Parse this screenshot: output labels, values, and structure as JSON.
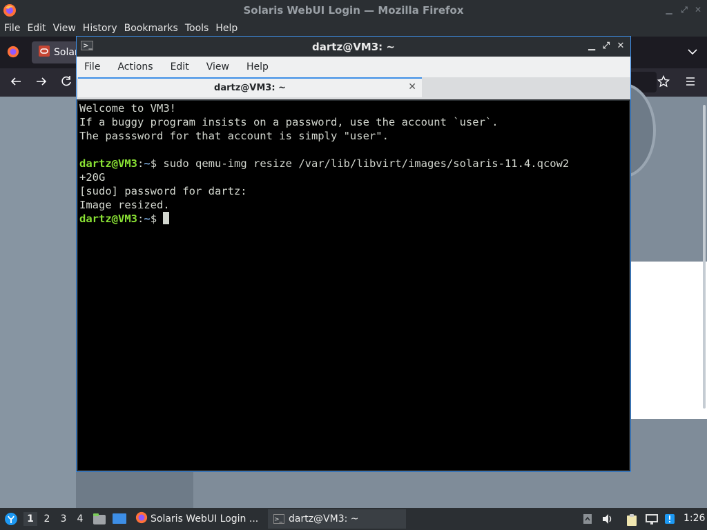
{
  "firefox": {
    "window_title": "Solaris WebUI Login — Mozilla Firefox",
    "menu": [
      "File",
      "Edit",
      "View",
      "History",
      "Bookmarks",
      "Tools",
      "Help"
    ],
    "tab_label": "Solar",
    "nav_icons": [
      "back-icon",
      "forward-icon",
      "reload-icon",
      "star-icon",
      "hamburger-menu-icon"
    ]
  },
  "terminal": {
    "window_title": "dartz@VM3: ~",
    "menu": [
      "File",
      "Actions",
      "Edit",
      "View",
      "Help"
    ],
    "tab_label": "dartz@VM3: ~",
    "lines": [
      "Welcome to VM3!",
      "If a buggy program insists on a password, use the account `user`.",
      "The passsword for that account is simply \"user\"."
    ],
    "prompt_user": "dartz@VM3",
    "prompt_sep": ":",
    "prompt_path": "~",
    "prompt_char": "$",
    "command": " sudo qemu-img resize /var/lib/libvirt/images/solaris-11.4.qcow2",
    "command_wrap": "+20G",
    "output": [
      "[sudo] password for dartz:",
      "Image resized."
    ]
  },
  "panel": {
    "workspaces": [
      "1",
      "2",
      "3",
      "4"
    ],
    "tasks": [
      "Solaris WebUI Login ...",
      "dartz@VM3: ~"
    ],
    "clock": "1:26"
  },
  "colors": {
    "prompt_user": "#8ae234",
    "prompt_path": "#729fcf",
    "accent": "#3d8ee6"
  }
}
